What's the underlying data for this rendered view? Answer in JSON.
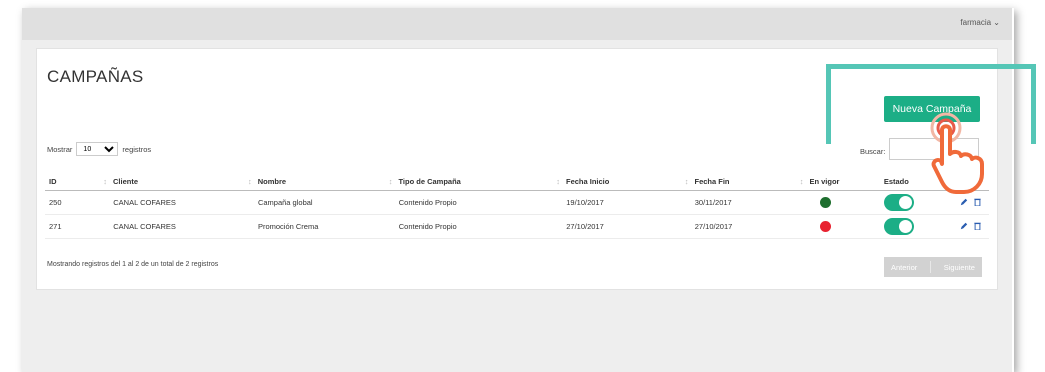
{
  "header": {
    "user_menu": "farmacia ⌄"
  },
  "page": {
    "title": "CAMPAÑAS",
    "new_button": "Nueva Campaña"
  },
  "controls": {
    "show_prefix": "Mostrar",
    "page_size": "10",
    "show_suffix": "registros",
    "search_label": "Buscar:",
    "search_value": ""
  },
  "table": {
    "columns": [
      "ID",
      "Cliente",
      "Nombre",
      "Tipo de Campaña",
      "Fecha Inicio",
      "Fecha Fin",
      "En vigor",
      "Estado",
      ""
    ],
    "rows": [
      {
        "id": "250",
        "cliente": "CANAL COFARES",
        "nombre": "Campaña global",
        "tipo": "Contenido Propio",
        "inicio": "19/10/2017",
        "fin": "30/11/2017",
        "en_vigor_color": "#1e6e2e",
        "estado": "on"
      },
      {
        "id": "271",
        "cliente": "CANAL COFARES",
        "nombre": "Promoción Crema",
        "tipo": "Contenido Propio",
        "inicio": "27/10/2017",
        "fin": "27/10/2017",
        "en_vigor_color": "#e82230",
        "estado": "on"
      }
    ]
  },
  "footer": {
    "info": "Mostrando registros del 1 al 2 de un total de 2 registros",
    "prev": "Anterior",
    "next": "Siguiente"
  },
  "colors": {
    "accent": "#1cae86",
    "frame": "#55c6b6",
    "hand": "#f06a3a"
  },
  "icons": {
    "edit": "pencil-icon",
    "delete": "trash-icon",
    "cursor": "hand-pointer-icon"
  }
}
